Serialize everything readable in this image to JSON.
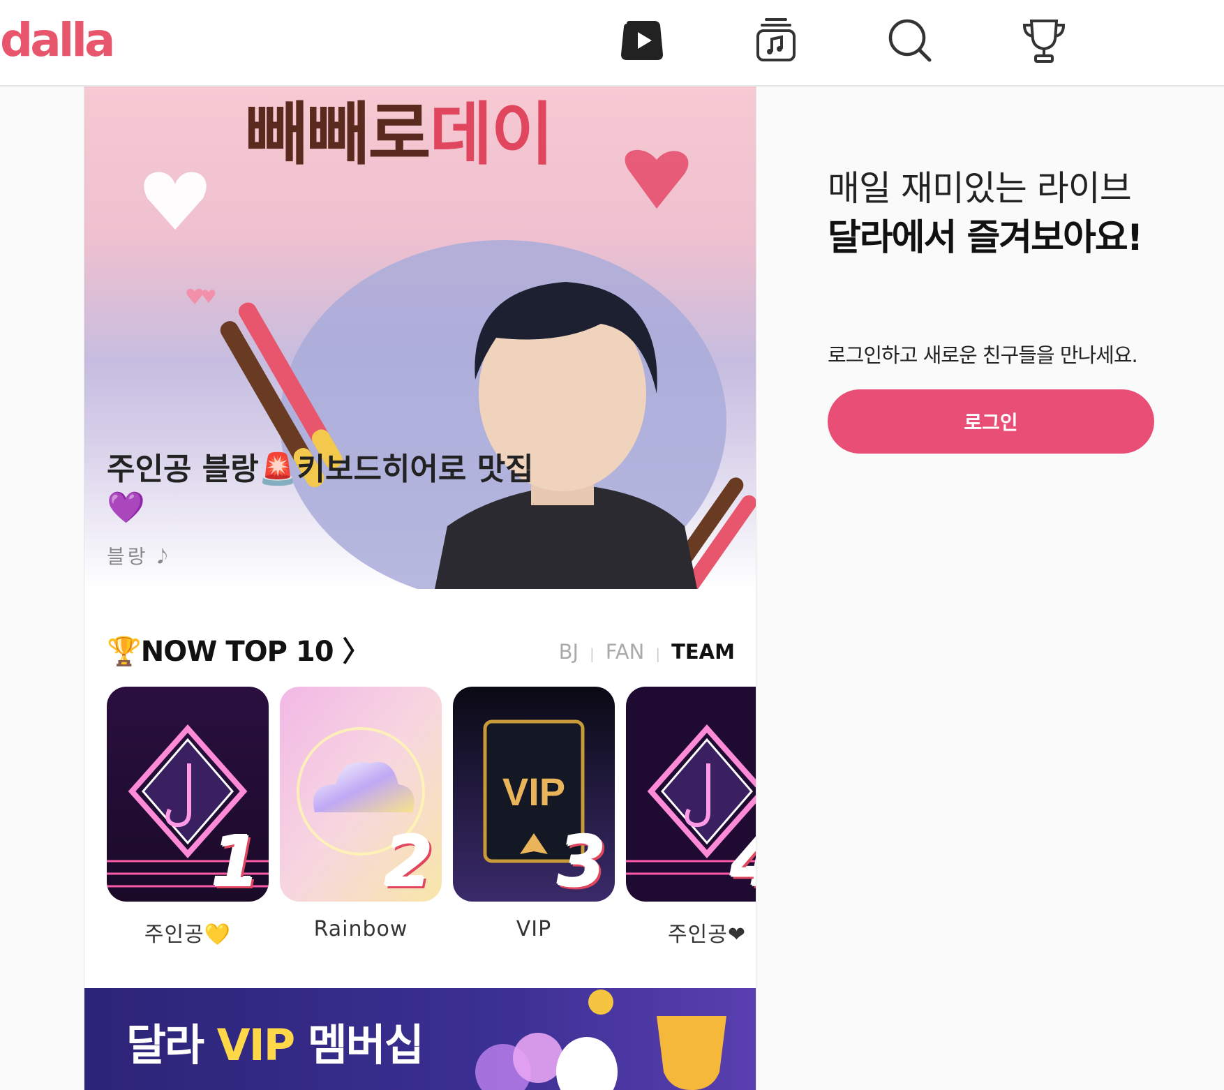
{
  "header": {
    "logo_text": "dalla",
    "nav": [
      {
        "name": "live",
        "icon": "play-icon"
      },
      {
        "name": "clip",
        "icon": "music-clip-icon"
      },
      {
        "name": "search",
        "icon": "search-icon"
      },
      {
        "name": "ranking",
        "icon": "trophy-icon"
      }
    ]
  },
  "hero": {
    "banner_title_part1": "빼빼로",
    "banner_title_part2": "데이",
    "caption": "주인공 블랑🚨키보드히어로 맛집",
    "caption_heart": "💜",
    "author": "블랑 𝅘𝅥𝅮"
  },
  "ranking": {
    "title": "🏆NOW TOP 10 〉",
    "tabs": [
      "BJ",
      "FAN",
      "TEAM"
    ],
    "active_tab": "TEAM",
    "items": [
      {
        "rank": "1",
        "name": "주인공💛"
      },
      {
        "rank": "2",
        "name": "Rainbow"
      },
      {
        "rank": "3",
        "name": "VIP"
      },
      {
        "rank": "4",
        "name": "주인공❤"
      }
    ],
    "vip_badge_text": "VIP"
  },
  "banner": {
    "text_white": "달라 ",
    "text_yellow": "VIP ",
    "text_white2": "멤버십"
  },
  "panel": {
    "headline1": "매일 재미있는 라이브",
    "headline2": "달라에서 즐겨보아요!",
    "subline": "로그인하고 새로운 친구들을 만나세요.",
    "login_label": "로그인"
  },
  "colors": {
    "brand": "#e8566d",
    "login_button": "#e94f76",
    "banner_bg": "#2c2477",
    "banner_accent": "#ffd84a"
  }
}
